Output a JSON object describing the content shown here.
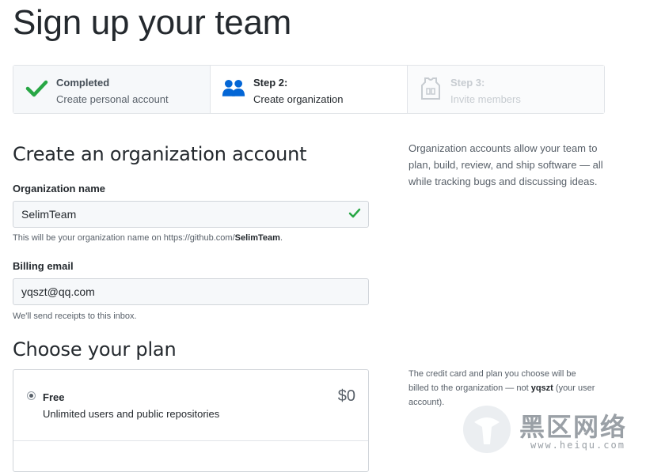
{
  "page": {
    "title": "Sign up your team"
  },
  "steps": [
    {
      "title": "Completed",
      "desc": "Create personal account",
      "icon": "check-icon",
      "state": "completed"
    },
    {
      "title": "Step 2:",
      "desc": "Create organization",
      "icon": "people-icon",
      "state": "current"
    },
    {
      "title": "Step 3:",
      "desc": "Invite members",
      "icon": "jersey-icon",
      "state": "pending"
    }
  ],
  "org_section": {
    "heading": "Create an organization account",
    "side_text": "Organization accounts allow your team to plan, build, review, and ship software — all while tracking bugs and discussing ideas."
  },
  "org_name": {
    "label": "Organization name",
    "value": "SelimTeam",
    "hint_prefix": "This will be your organization name on https://github.com/",
    "hint_name": "SelimTeam",
    "hint_suffix": "."
  },
  "billing": {
    "label": "Billing email",
    "value": "yqszt@qq.com",
    "hint": "We'll send receipts to this inbox."
  },
  "plan_section": {
    "heading": "Choose your plan",
    "side_prefix": "The credit card and plan you choose will be billed to the organization — not ",
    "side_user": "yqszt",
    "side_suffix": " (your user account)."
  },
  "plans": [
    {
      "name": "Free",
      "desc": "Unlimited users and public repositories",
      "price": "$0",
      "selected": true
    }
  ],
  "watermark": {
    "text": "黑区网络",
    "url": "www.heiqu.com"
  },
  "colors": {
    "success": "#28a745",
    "accent": "#0366d6",
    "muted": "#586069"
  }
}
